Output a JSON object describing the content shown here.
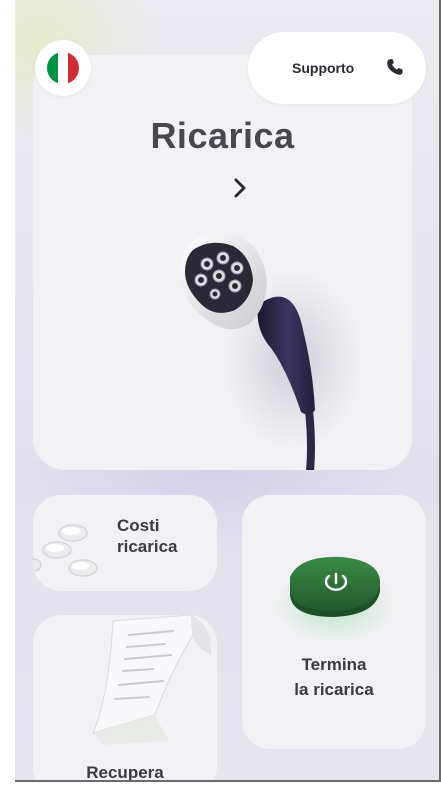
{
  "header": {
    "flag": {
      "icon": "italy-flag-icon",
      "colors": [
        "#009246",
        "#ffffff",
        "#ce2b37"
      ]
    },
    "support": {
      "label": "Supporto",
      "icon": "phone-icon"
    }
  },
  "hero": {
    "title": "Ricarica",
    "icon": "chevron-right-icon",
    "image": "ev-charger-plug"
  },
  "tiles": {
    "costs": {
      "label_line1": "Costi",
      "label_line2": "ricarica",
      "image": "coins"
    },
    "end": {
      "label_line1": "Termina",
      "label_line2": "la ricarica",
      "icon": "power-icon",
      "accent": "#2f6b3a"
    },
    "recover": {
      "label": "Recupera",
      "image": "receipt"
    }
  },
  "colors": {
    "background": "#e7e6ef",
    "card": "#f2f2f6",
    "text": "#3a3a42",
    "plug_body": "#2e2846"
  }
}
